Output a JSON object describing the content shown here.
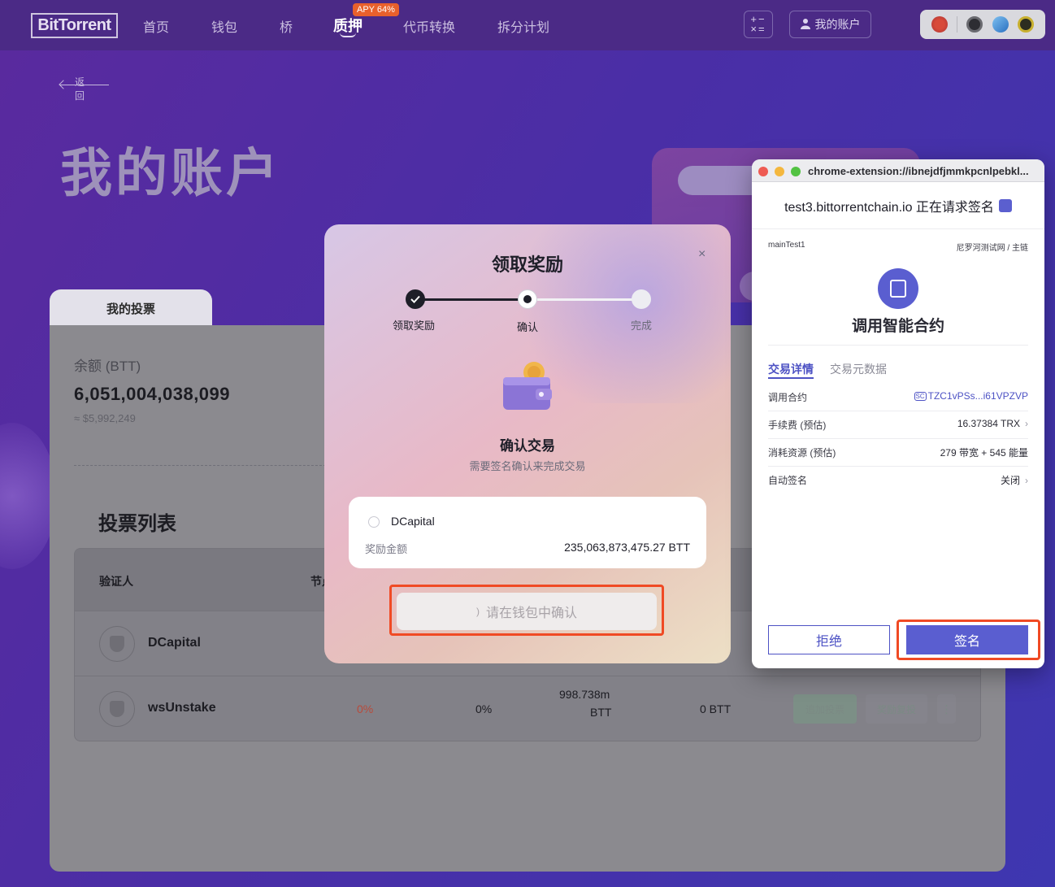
{
  "nav": {
    "logo": "BitTorrent",
    "items": [
      "首页",
      "钱包",
      "桥",
      "质押",
      "代币转换",
      "拆分计划"
    ],
    "apy_badge": "APY 64%",
    "account": "我的账户",
    "calc_icon": "+−×="
  },
  "page": {
    "back": "返回",
    "title": "我的账户"
  },
  "card": {
    "tab": "我的投票",
    "balance_label": "余额 (BTT)",
    "balance_value": "6,051,004,038,099",
    "balance_usd": "≈ $5,992,249",
    "list_title": "投票列表",
    "columns": [
      "验证人",
      "节点"
    ],
    "rows": [
      {
        "name": "DCapital"
      },
      {
        "name": "wsUnstake",
        "c1": "0%",
        "c2": "0%",
        "c3a": "998.738m",
        "c3b": "BTT",
        "c4": "0 BTT",
        "btn1": "追加投票",
        "btn2": "奖励复投",
        "more": "⋮"
      }
    ]
  },
  "modal": {
    "title": "领取奖励",
    "close": "×",
    "steps": [
      "领取奖励",
      "确认",
      "完成"
    ],
    "confirm_title": "确认交易",
    "confirm_sub": "需要签名确认来完成交易",
    "validator": "DCapital",
    "reward_label": "奖励金额",
    "reward_value": "235,063,873,475.27 BTT",
    "pending_button": "请在钱包中确认",
    "spinner": ")"
  },
  "popup": {
    "url": "chrome-extension://ibnejdfjmmkpcnlpebkl...",
    "header": "test3.bittorrentchain.io 正在请求签名",
    "account": "mainTest1",
    "network": "尼罗河测试网 / 主链",
    "contract_title": "调用智能合约",
    "tabs": [
      "交易详情",
      "交易元数据"
    ],
    "rows": [
      {
        "key": "调用合约",
        "badge": "SC",
        "value": "TZC1vPSs...i61VPZVP"
      },
      {
        "key": "手续费 (预估)",
        "value": "16.37384 TRX",
        "chev": "›"
      },
      {
        "key": "消耗资源 (预估)",
        "value": "279 带宽 + 545 能量"
      },
      {
        "key": "自动签名",
        "value": "关闭",
        "chev": "›"
      }
    ],
    "reject": "拒绝",
    "sign": "签名"
  },
  "colors": {
    "accent": "#5a5ed0",
    "highlight": "#f04a24",
    "apy": "#e8602c"
  }
}
